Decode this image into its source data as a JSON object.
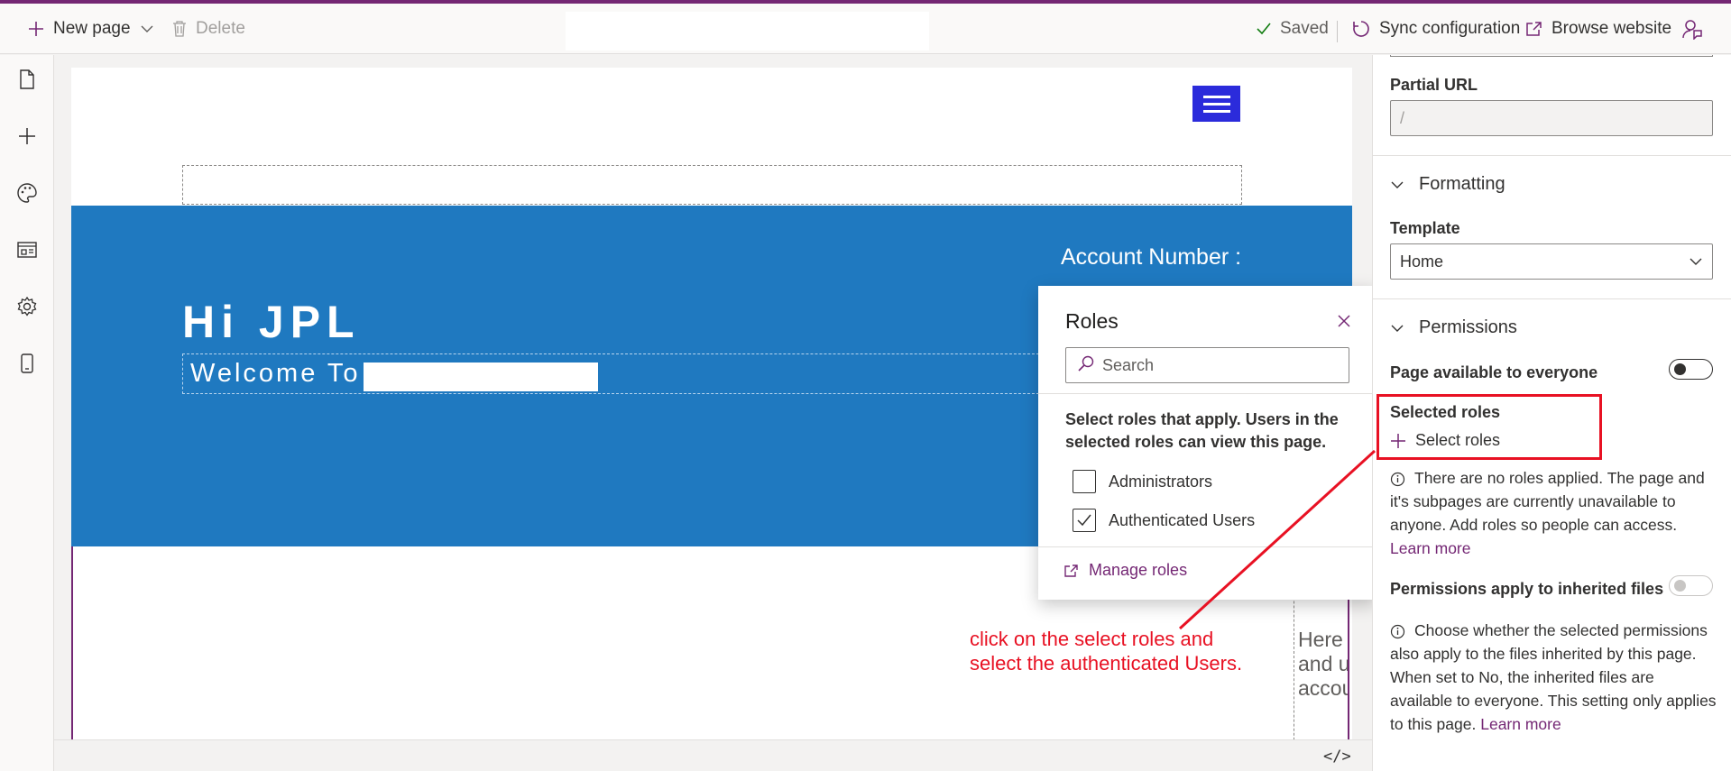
{
  "toolbar": {
    "new_page": "New page",
    "delete": "Delete",
    "saved": "Saved",
    "sync": "Sync configuration",
    "browse": "Browse website"
  },
  "left_rail": {
    "icons": [
      "pages-icon",
      "add-icon",
      "styling-icon",
      "templates-icon",
      "settings-icon",
      "mobile-icon"
    ]
  },
  "page_preview": {
    "greeting": "Hi JPL",
    "welcome": "Welcome To",
    "account_number": "Account Number :",
    "side_text": "Here you can view and update your account"
  },
  "canvas": {
    "code_view": "</>"
  },
  "roles_panel": {
    "title": "Roles",
    "search_placeholder": "Search",
    "description": "Select roles that apply. Users in the selected roles can view this page.",
    "roles": [
      {
        "label": "Administrators",
        "checked": false
      },
      {
        "label": "Authenticated Users",
        "checked": true
      }
    ],
    "manage_roles": "Manage roles"
  },
  "annotation": {
    "line1": "click on the select roles and",
    "line2": "select the authenticated Users."
  },
  "properties": {
    "partial_url_label": "Partial URL",
    "partial_url_value": "/",
    "formatting_header": "Formatting",
    "template_label": "Template",
    "template_value": "Home",
    "permissions_header": "Permissions",
    "available_label": "Page available to everyone",
    "available_on": false,
    "selected_roles_label": "Selected roles",
    "select_roles": "Select roles",
    "info1_text": "There are no roles applied. The page and it's subpages are currently unavailable to anyone. Add roles so people can access.",
    "learn_more": "Learn more",
    "inherit_label": "Permissions apply to inherited files",
    "inherit_on": false,
    "info2_text": "Choose whether the selected permissions also apply to the files inherited by this page. When set to No, the inherited files are available to everyone. This setting only applies to this page."
  },
  "colors": {
    "accent": "#742774",
    "hero": "#1f79c0",
    "menu_button": "#2b2bdb",
    "annotation": "#e81123"
  }
}
